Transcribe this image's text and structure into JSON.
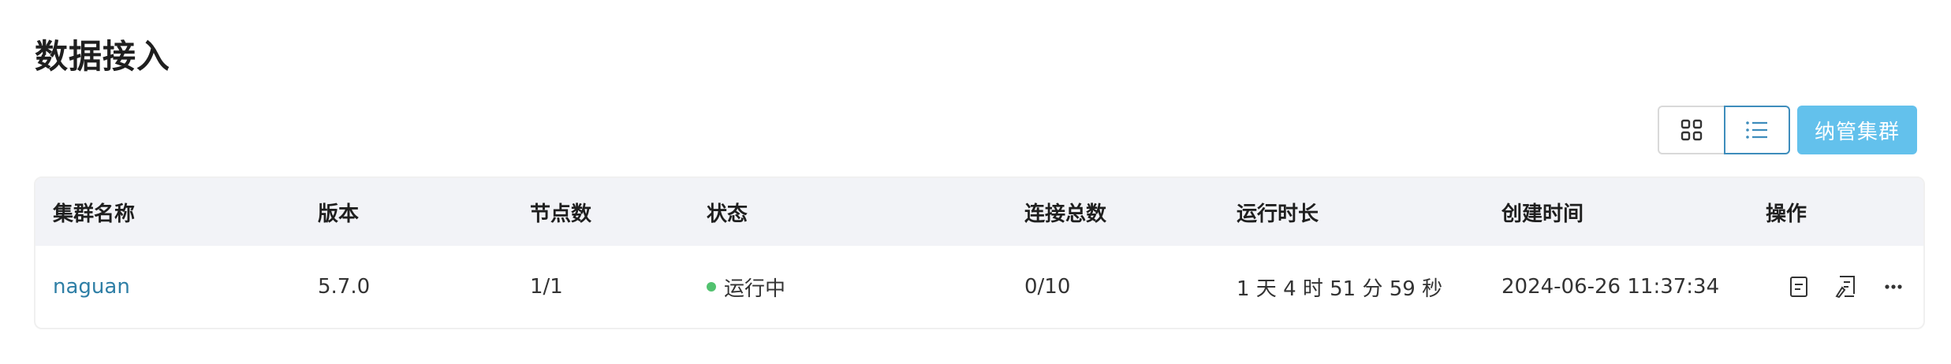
{
  "page": {
    "title": "数据接入"
  },
  "toolbar": {
    "grid_view_icon": "grid-icon",
    "list_view_icon": "list-icon",
    "active_view": "list",
    "add_cluster_label": "纳管集群"
  },
  "table": {
    "columns": [
      "集群名称",
      "版本",
      "节点数",
      "状态",
      "连接总数",
      "运行时长",
      "创建时间",
      "操作"
    ],
    "rows": [
      {
        "name": "naguan",
        "version": "5.7.0",
        "nodes": "1/1",
        "status": "运行中",
        "connections": "0/10",
        "uptime": "1 天 4 时 51 分 59 秒",
        "created": "2024-06-26 11:37:34",
        "actions": [
          "document-icon",
          "edit-document-icon",
          "more-icon"
        ]
      }
    ]
  },
  "colors": {
    "accent": "#3e8dbc",
    "primary_button": "#63c1ec",
    "status_running": "#52c26f",
    "header_bg": "#f2f3f7"
  }
}
